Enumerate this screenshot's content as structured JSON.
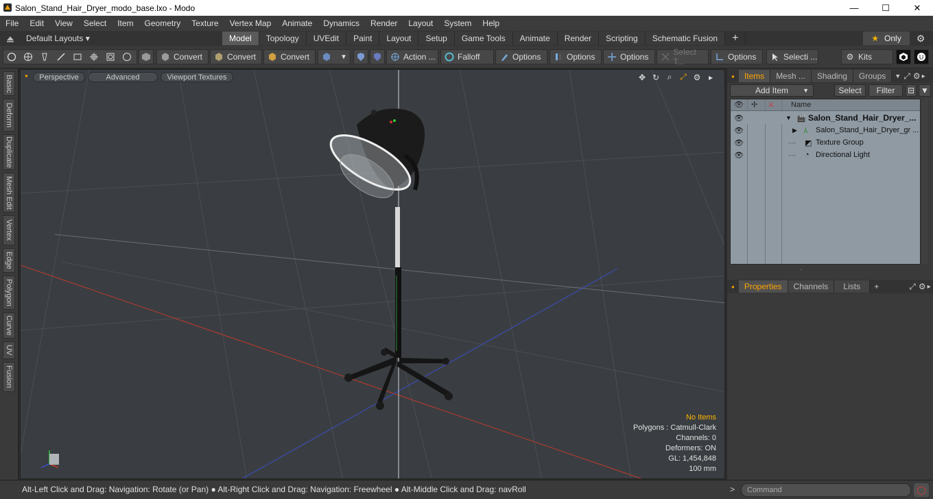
{
  "window": {
    "title": "Salon_Stand_Hair_Dryer_modo_base.lxo - Modo",
    "minimize": "—",
    "maximize": "☐",
    "close": "✕"
  },
  "menu": [
    "File",
    "Edit",
    "View",
    "Select",
    "Item",
    "Geometry",
    "Texture",
    "Vertex Map",
    "Animate",
    "Dynamics",
    "Render",
    "Layout",
    "System",
    "Help"
  ],
  "layouts": {
    "dropdown": "Default Layouts ▾",
    "tabs": [
      "Model",
      "Topology",
      "UVEdit",
      "Paint",
      "Layout",
      "Setup",
      "Game Tools",
      "Animate",
      "Render",
      "Scripting",
      "Schematic Fusion"
    ],
    "active_tab": "Model",
    "add": "+",
    "only_label": "Only"
  },
  "toolbar": {
    "convert1": "Convert",
    "convert2": "Convert",
    "convert3": "Convert",
    "action": "Action ...",
    "falloff": "Falloff",
    "options1": "Options",
    "options2": "Options",
    "options3": "Options",
    "select_t": "Select T...",
    "options4": "Options",
    "selecti": "Selecti ...",
    "kits": "Kits"
  },
  "left_tabs": [
    "Basic",
    "Deform",
    "Duplicate",
    "Mesh Edit",
    "Vertex",
    "Edge",
    "Polygon",
    "Curve",
    "UV",
    "Fusion"
  ],
  "viewport": {
    "perspective": "Perspective",
    "advanced": "Advanced",
    "viewport_textures": "Viewport Textures",
    "info": {
      "no_items": "No Items",
      "polygons": "Polygons : Catmull-Clark",
      "channels": "Channels: 0",
      "deformers": "Deformers: ON",
      "gl": "GL: 1,454,848",
      "scale": "100 mm"
    }
  },
  "items_panel": {
    "tabs": [
      "Items",
      "Mesh ...",
      "Shading",
      "Groups"
    ],
    "active_tab": "Items",
    "add_item": "Add Item",
    "select": "Select",
    "filter": "Filter",
    "name_header": "Name",
    "rows": [
      {
        "label": "Salon_Stand_Hair_Dryer_...",
        "bold": true
      },
      {
        "label": "Salon_Stand_Hair_Dryer_gr ...",
        "bold": false
      },
      {
        "label": "Texture Group",
        "bold": false
      },
      {
        "label": "Directional Light",
        "bold": false
      }
    ]
  },
  "properties_panel": {
    "tabs": [
      "Properties",
      "Channels",
      "Lists"
    ],
    "active_tab": "Properties",
    "add": "+"
  },
  "status": {
    "text": "Alt-Left Click and Drag: Navigation: Rotate (or Pan) ● Alt-Right Click and Drag: Navigation: Freewheel ● Alt-Middle Click and Drag: navRoll",
    "command_placeholder": "Command",
    "prompt": ">"
  },
  "colors": {
    "accent": "#ffa500",
    "viewport_bg": "#3a3e42",
    "axis_x": "#c0392b",
    "axis_z": "#3a4fc9",
    "axis_y": "#2ecc40"
  }
}
